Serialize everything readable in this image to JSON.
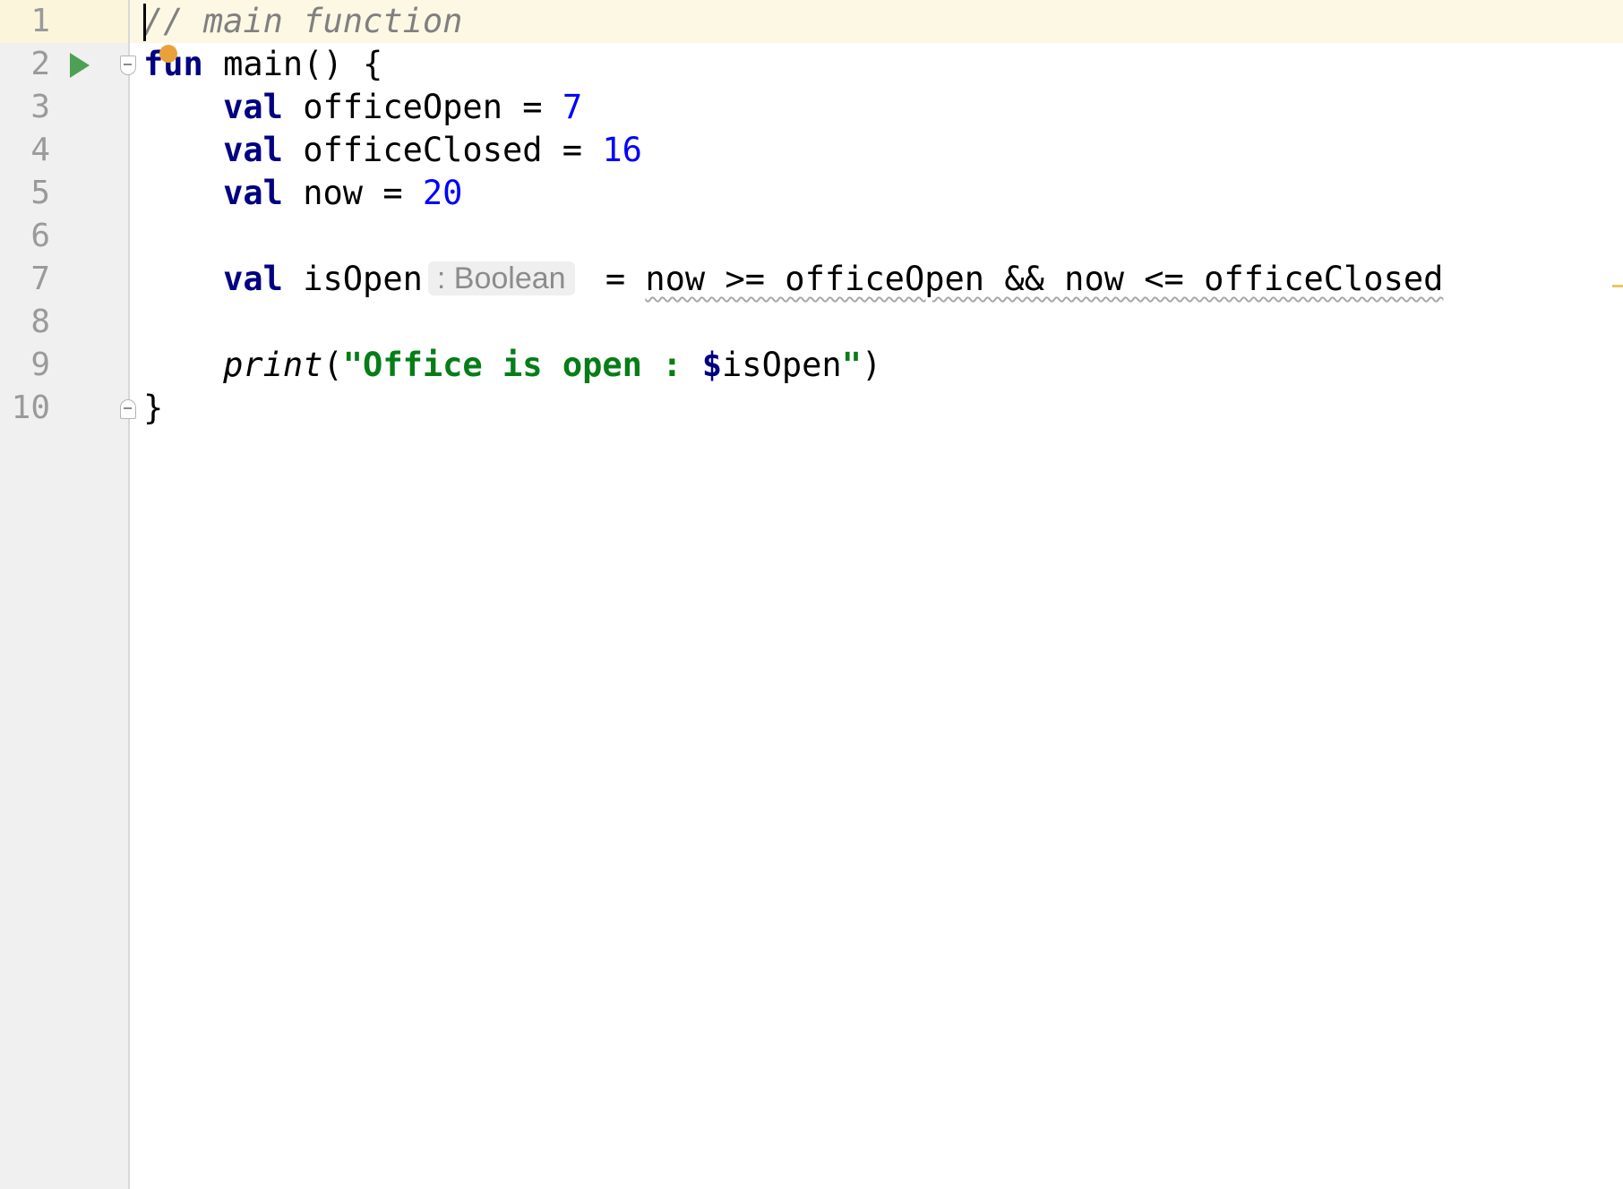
{
  "editor": {
    "line_numbers": [
      "1",
      "2",
      "3",
      "4",
      "5",
      "6",
      "7",
      "8",
      "9",
      "10"
    ],
    "code": {
      "line1": {
        "comment": "// main function"
      },
      "line2": {
        "kw": "fun",
        "rest": " main() {"
      },
      "line3": {
        "indent": "    ",
        "kw": "val",
        "name": " officeOpen = ",
        "value": "7"
      },
      "line4": {
        "indent": "    ",
        "kw": "val",
        "name": " officeClosed = ",
        "value": "16"
      },
      "line5": {
        "indent": "    ",
        "kw": "val",
        "name": " now = ",
        "value": "20"
      },
      "line7": {
        "indent": "    ",
        "kw": "val",
        "name": " isOpen",
        "type_hint": ": Boolean",
        "eq": " = ",
        "expr": "now >= officeOpen && now <= officeClosed"
      },
      "line9": {
        "indent": "    ",
        "fn": "print",
        "open_paren": "(",
        "str_open": "\"Office is open : ",
        "tmpl_dollar": "$",
        "tmpl_var": "isOpen",
        "str_close": "\"",
        "close_paren": ")"
      },
      "line10": {
        "text": "}"
      }
    },
    "colors": {
      "keyword": "#000080",
      "number": "#0000ff",
      "comment": "#808080",
      "string": "#067d17",
      "current_line": "#fdf8e4",
      "run_icon": "#4ea154",
      "intention_bulb": "#e9a23b"
    },
    "icons": [
      "run-icon",
      "fold-open-icon",
      "fold-close-icon",
      "intention-bulb-icon"
    ]
  }
}
